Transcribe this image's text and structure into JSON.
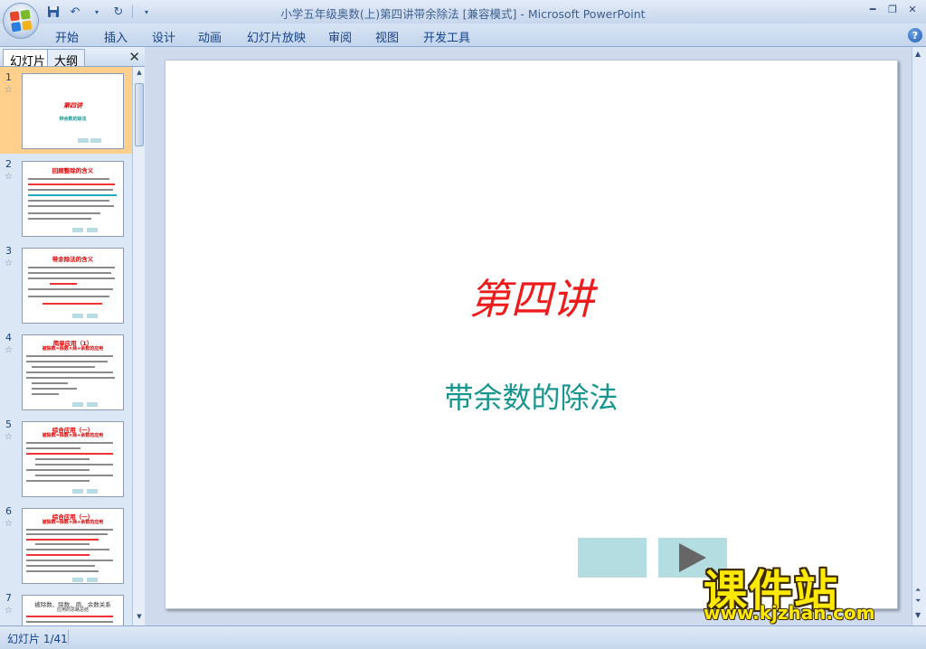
{
  "window": {
    "title": "小学五年级奥数(上)第四讲带余除法 [兼容模式] - Microsoft PowerPoint"
  },
  "quick_access": {
    "save_icon": "save-icon",
    "undo_icon": "undo-icon",
    "redo_icon": "redo-icon"
  },
  "ribbon": {
    "tabs": [
      "开始",
      "插入",
      "设计",
      "动画",
      "幻灯片放映",
      "审阅",
      "视图",
      "开发工具"
    ]
  },
  "left_panel": {
    "tab_slides": "幻灯片",
    "tab_outline": "大纲",
    "thumbnails": [
      {
        "num": "1",
        "title": "第四讲",
        "subtitle": "带余数的除法"
      },
      {
        "num": "2",
        "title": "回顾整除的含义",
        "subtitle": ""
      },
      {
        "num": "3",
        "title": "带余除法的含义",
        "subtitle": ""
      },
      {
        "num": "4",
        "title": "简单应用（1）",
        "subtitle": "被除数=除数×商+余数的应用"
      },
      {
        "num": "5",
        "title": "综合应用（一）",
        "subtitle": "被除数=除数×商+余数的应用"
      },
      {
        "num": "6",
        "title": "综合应用（一）",
        "subtitle": "被除数=除数×商+余数的应用"
      },
      {
        "num": "7",
        "title": "被除数、除数、商、余数关系",
        "subtitle": "应用的思路总结"
      }
    ]
  },
  "slide": {
    "title": "第四讲",
    "subtitle": "带余数的除法"
  },
  "watermark": {
    "brand": "课件站",
    "url": "www.kjzhan.com"
  },
  "status": {
    "slide_indicator": "幻灯片 1/41"
  },
  "colors": {
    "title_red": "#ee1b1b",
    "subtitle_teal": "#17958f",
    "selected_thumb": "#ffcf8b",
    "nav_button": "#b3dde1"
  }
}
